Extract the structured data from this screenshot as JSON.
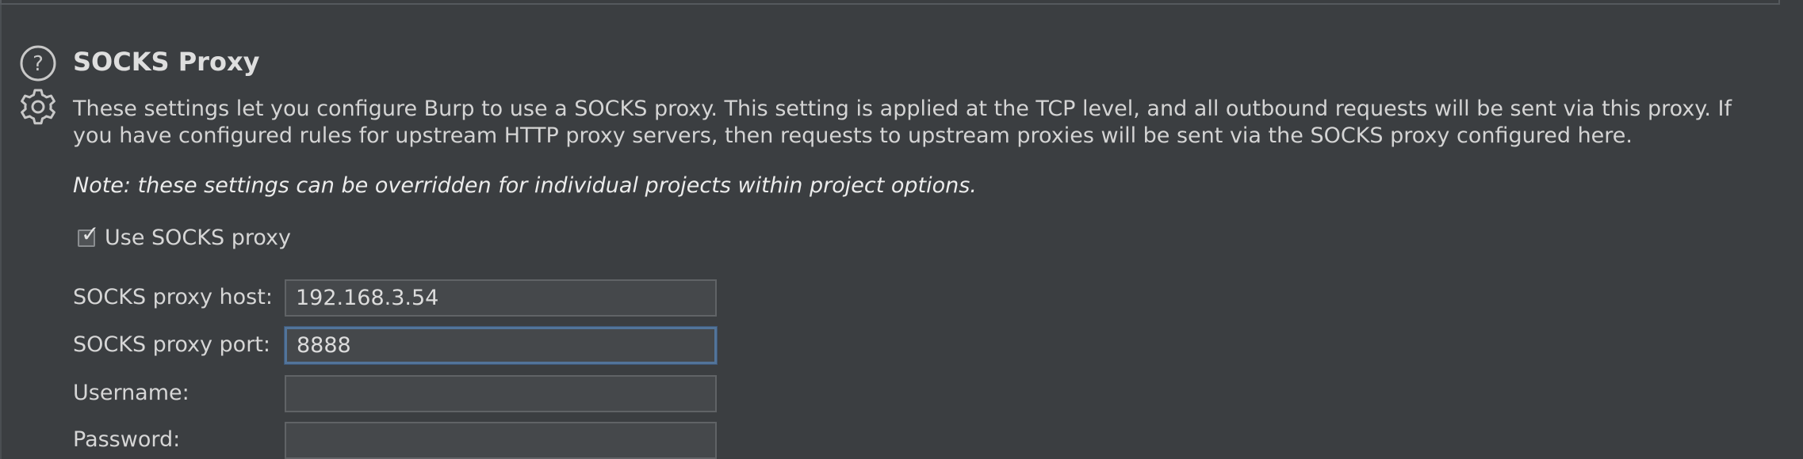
{
  "section": {
    "title": "SOCKS Proxy",
    "description_line1": "These settings let you configure Burp to use a SOCKS proxy. This setting is applied at the TCP level, and all outbound requests will be sent via this proxy. If",
    "description_line2": "you have configured rules for upstream HTTP proxy servers, then requests to upstream proxies will be sent via the SOCKS proxy configured here.",
    "note": "Note: these settings can be overridden for individual projects within project options."
  },
  "use_socks": {
    "label": "Use SOCKS proxy",
    "checked": true
  },
  "fields": {
    "host_label": "SOCKS proxy host:",
    "host_value": "192.168.3.54",
    "port_label": "SOCKS proxy port:",
    "port_value": "8888",
    "username_label": "Username:",
    "username_value": "",
    "password_label": "Password:",
    "password_value": ""
  },
  "icons": {
    "help": "help-circle-icon",
    "settings": "gear-icon"
  },
  "colors": {
    "background": "#3b3e41",
    "focus_border": "#52749a",
    "field_background": "#45484b"
  }
}
